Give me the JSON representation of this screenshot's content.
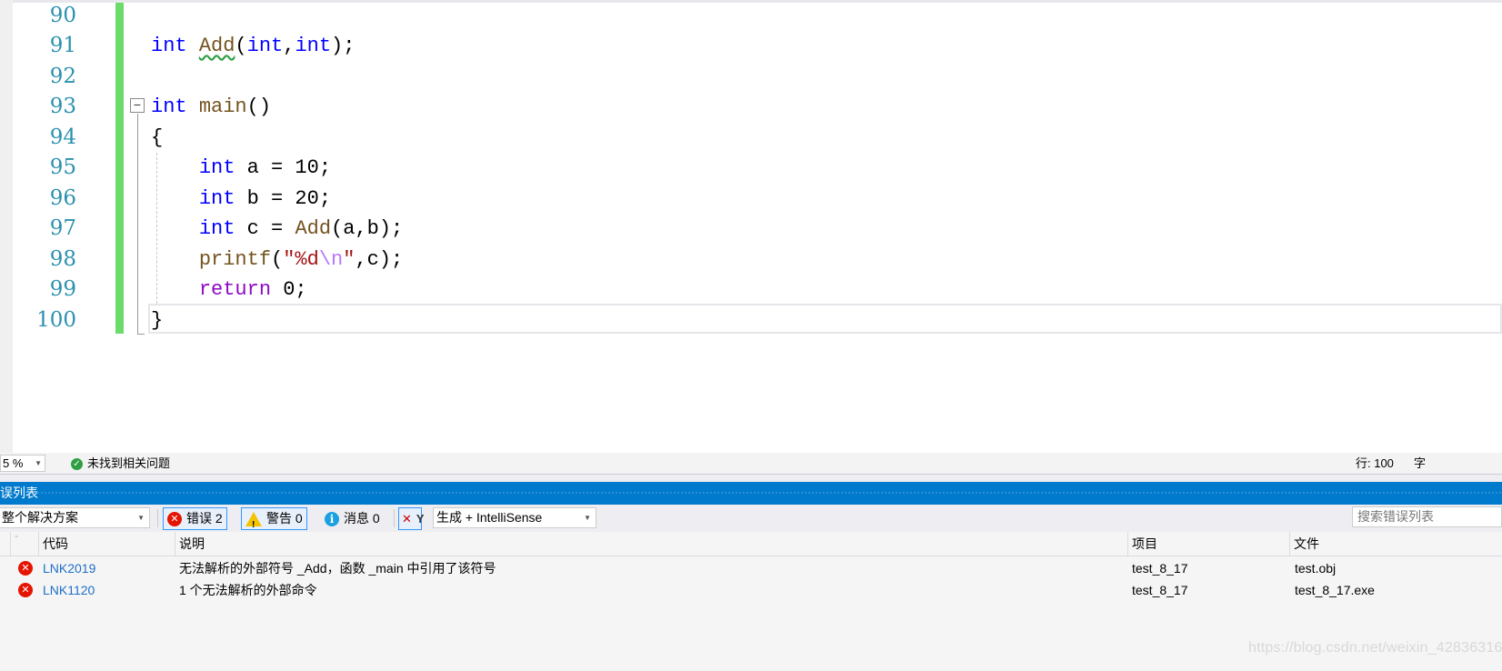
{
  "editor": {
    "line_numbers": [
      "90",
      "91",
      "92",
      "93",
      "94",
      "95",
      "96",
      "97",
      "98",
      "99",
      "100"
    ],
    "lines": [
      [],
      [
        {
          "t": "int",
          "c": "kw"
        },
        {
          "t": " "
        },
        {
          "t": "Add",
          "c": "fn squig"
        },
        {
          "t": "("
        },
        {
          "t": "int",
          "c": "kw"
        },
        {
          "t": ","
        },
        {
          "t": "int",
          "c": "kw"
        },
        {
          "t": ");"
        }
      ],
      [],
      [
        {
          "t": "int",
          "c": "kw"
        },
        {
          "t": " "
        },
        {
          "t": "main",
          "c": "fn"
        },
        {
          "t": "()"
        }
      ],
      [
        {
          "t": "{"
        }
      ],
      [
        {
          "t": "    "
        },
        {
          "t": "int",
          "c": "kw"
        },
        {
          "t": " a = 10;"
        }
      ],
      [
        {
          "t": "    "
        },
        {
          "t": "int",
          "c": "kw"
        },
        {
          "t": " b = 20;"
        }
      ],
      [
        {
          "t": "    "
        },
        {
          "t": "int",
          "c": "kw"
        },
        {
          "t": " c = "
        },
        {
          "t": "Add",
          "c": "fn"
        },
        {
          "t": "(a,b);"
        }
      ],
      [
        {
          "t": "    "
        },
        {
          "t": "printf",
          "c": "fn"
        },
        {
          "t": "("
        },
        {
          "t": "\"%d",
          "c": "str"
        },
        {
          "t": "\\n",
          "c": "esc"
        },
        {
          "t": "\"",
          "c": "str"
        },
        {
          "t": ",c);"
        }
      ],
      [
        {
          "t": "    "
        },
        {
          "t": "return",
          "c": "ctl"
        },
        {
          "t": " 0;"
        }
      ],
      [
        {
          "t": "}"
        }
      ]
    ],
    "fold_glyph": "−"
  },
  "status": {
    "zoom": "5 %",
    "issues": "未找到相关问题",
    "line": "行: 100",
    "col": "字"
  },
  "error_list": {
    "title": "误列表",
    "scope": "整个解决方案",
    "errors_label": "错误 2",
    "warnings_label": "警告 0",
    "messages_label": "消息 0",
    "build_filter": "生成 + IntelliSense",
    "search_placeholder": "搜索错误列表",
    "columns": {
      "code": "代码",
      "description": "说明",
      "project": "项目",
      "file": "文件"
    },
    "rows": [
      {
        "code": "LNK2019",
        "description": "无法解析的外部符号 _Add，函数 _main 中引用了该符号",
        "project": "test_8_17",
        "file": "test.obj"
      },
      {
        "code": "LNK1120",
        "description": "1 个无法解析的外部命令",
        "project": "test_8_17",
        "file": "test_8_17.exe"
      }
    ]
  },
  "watermark": "https://blog.csdn.net/weixin_42836316",
  "colors": {
    "accent": "#007acc",
    "keyword": "#0000ff",
    "function": "#74531f",
    "error": "#e51400",
    "changed_bar": "#6bdb6b"
  }
}
